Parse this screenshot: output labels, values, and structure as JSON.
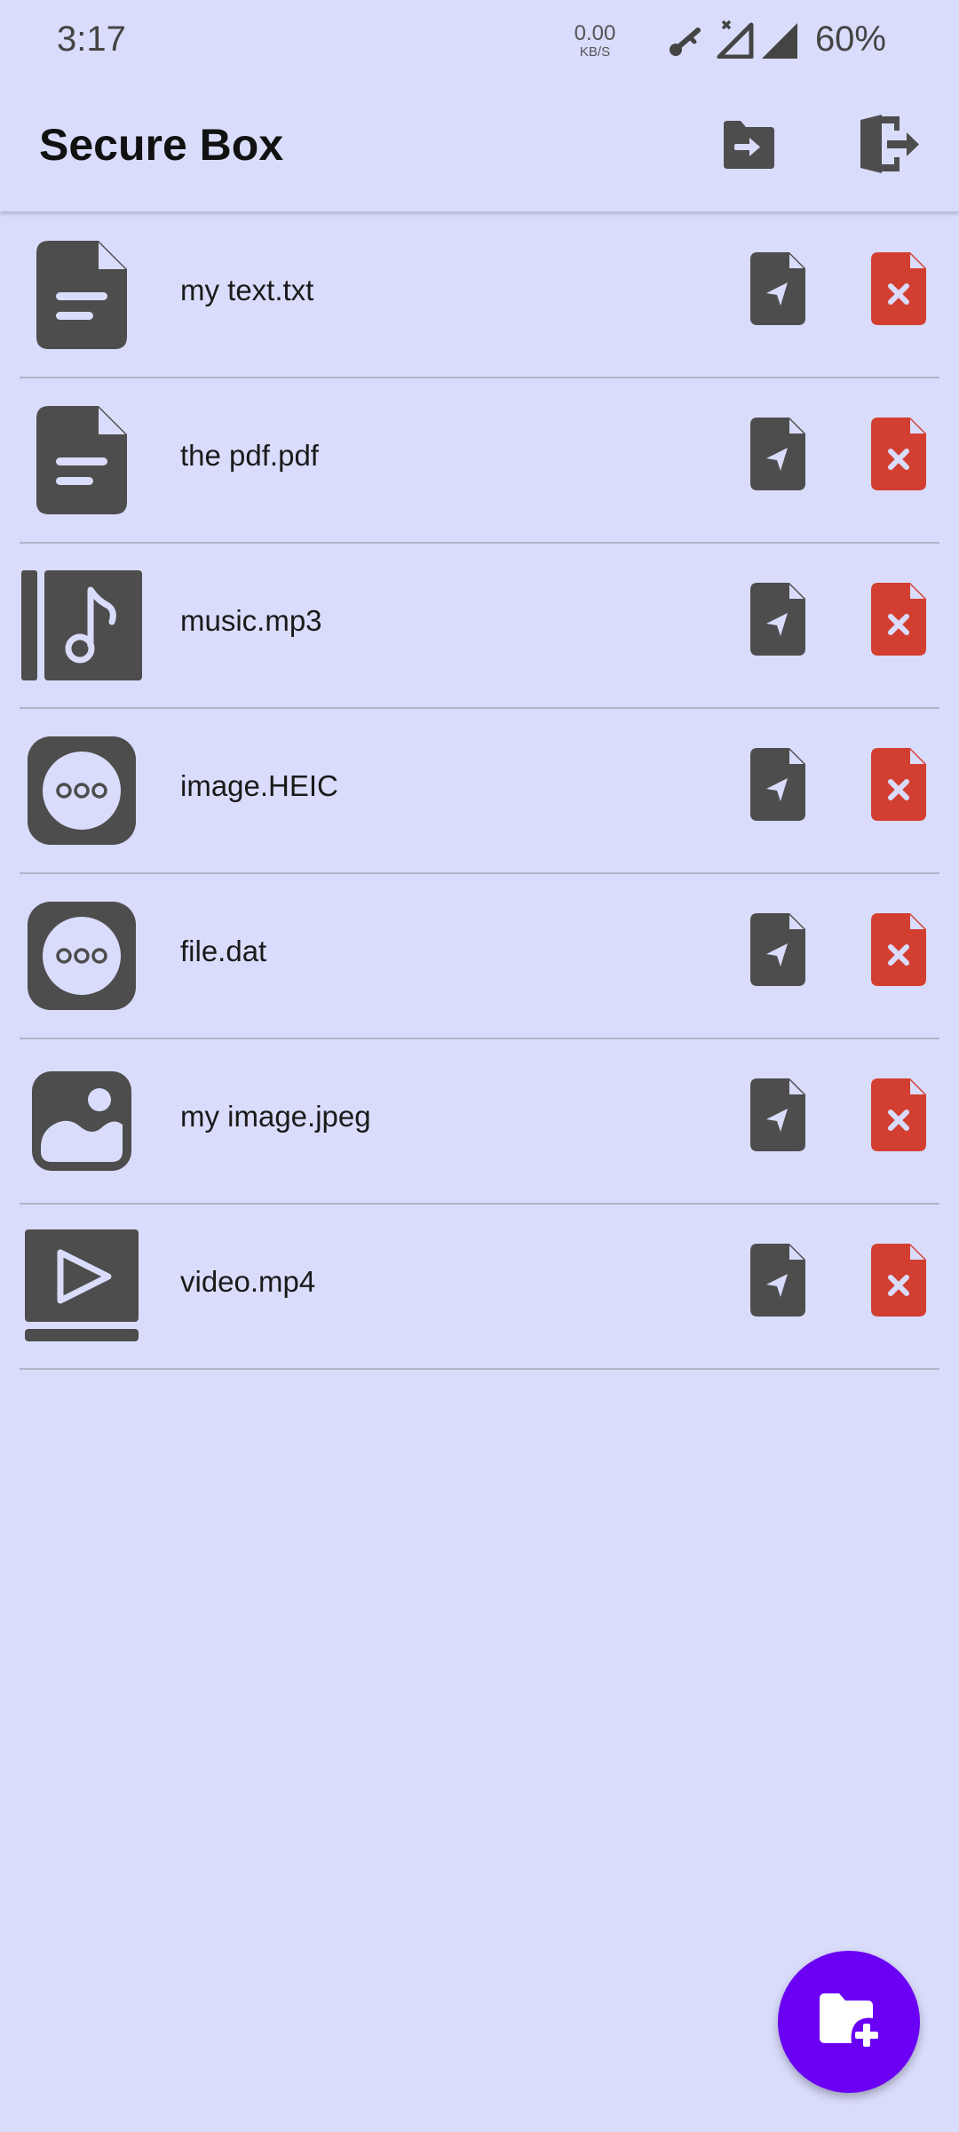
{
  "status_bar": {
    "time": "3:17",
    "net_speed_value": "0.00",
    "net_speed_unit": "KB/S",
    "battery": "60%",
    "icons": [
      "vpn-key-icon",
      "signal-no-data-icon",
      "signal-icon"
    ]
  },
  "app_bar": {
    "title": "Secure Box",
    "actions": [
      "folder-import-icon",
      "logout-icon"
    ]
  },
  "files": [
    {
      "name": "my text.txt",
      "icon": "text-file-icon"
    },
    {
      "name": "the pdf.pdf",
      "icon": "text-file-icon"
    },
    {
      "name": "music.mp3",
      "icon": "audio-file-icon"
    },
    {
      "name": "image.HEIC",
      "icon": "unknown-file-icon"
    },
    {
      "name": "file.dat",
      "icon": "unknown-file-icon"
    },
    {
      "name": "my image.jpeg",
      "icon": "image-file-icon"
    },
    {
      "name": "video.mp4",
      "icon": "video-file-icon"
    }
  ],
  "row_actions": [
    "move-file-icon",
    "delete-file-icon"
  ],
  "fab": {
    "icon": "add-folder-icon"
  },
  "colors": {
    "background": "#dadcfc",
    "icon_dark": "#4d4d4d",
    "delete_red": "#d23f31",
    "fab": "#6a00f4",
    "divider": "#b4b4c8"
  }
}
